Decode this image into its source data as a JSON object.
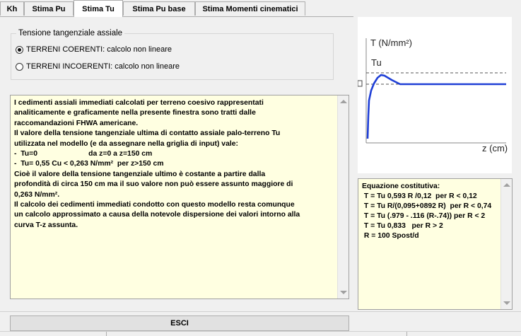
{
  "tabs": [
    {
      "label": "Kh",
      "active": false
    },
    {
      "label": "Stima Pu",
      "active": false
    },
    {
      "label": "Stima Tu",
      "active": true
    },
    {
      "label": "Stima Pu base",
      "active": false
    },
    {
      "label": "Stima Momenti cinematici",
      "active": false
    }
  ],
  "group": {
    "title": "Tensione tangenziale assiale",
    "options": [
      {
        "label": "TERRENI COERENTI:  calcolo non lineare",
        "checked": true
      },
      {
        "label": "TERRENI INCOERENTI:  calcolo non lineare",
        "checked": false
      }
    ]
  },
  "memo": {
    "text": "I cedimenti assiali immediati calcolati per terreno coesivo rappresentati\nanaliticamente e graficamente nella presente finestra sono tratti dalle\nraccomandazioni FHWA americane.\nIl valore della tensione tangenziale ultima di contatto assiale palo-terreno Tu\nutilizzata nel modello (e da assegnare nella griglia di input) vale:\n-  Tu=0                         da z=0 a z=150 cm\n-  Tu= 0,55 Cu < 0,263 N/mm²  per z>150 cm\nCioè il valore della tensione tangenziale ultimo è costante a partire dalla\nprofondità di circa 150 cm ma il suo valore non può essere assunto maggiore di\n0,263 N/mm².\nIl calcolo dei cedimenti immediati condotto con questo modello resta comunque\nun calcolo approssimato a causa della notevole dispersione dei valori intorno alla\ncurva T-z assunta."
  },
  "graph": {
    "y_axis_label": "T (N/mm²)",
    "x_axis_label": "z (cm)",
    "tu_label": "Tu",
    "curve_color": "#1f3fd6"
  },
  "equation": {
    "text": "Equazione costitutiva:\n T = Tu 0,593 R /0,12  per R < 0,12\n T = Tu R/(0,095+0892 R)  per R < 0,74\n T = Tu (.979 - .116 (R-.74)) per R < 2\n T = Tu 0,833   per R > 2\n R = 100 Spost/d"
  },
  "buttons": {
    "esci": "ESCI"
  }
}
